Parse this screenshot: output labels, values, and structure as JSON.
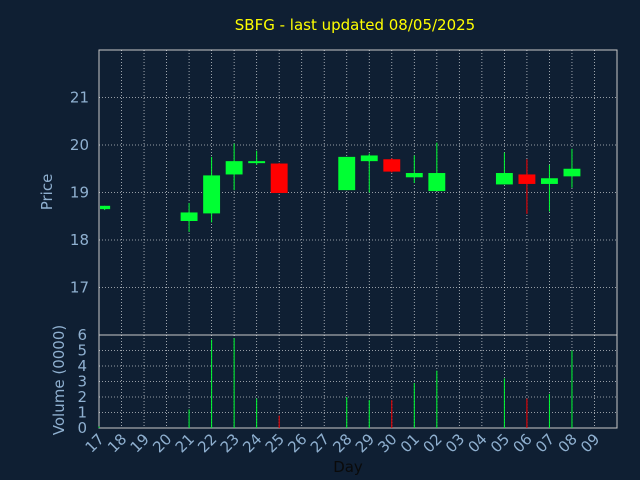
{
  "chart_data": [
    {
      "type": "candlestick",
      "title": "SBFG - last updated 08/05/2025",
      "xlabel": "Day",
      "ylabel": "Price",
      "ylim": [
        16,
        22
      ],
      "y_ticks": [
        "17",
        "18",
        "19",
        "20",
        "21"
      ],
      "x_ticks": [
        "17",
        "18",
        "19",
        "20",
        "21",
        "22",
        "23",
        "24",
        "25",
        "26",
        "27",
        "28",
        "29",
        "30",
        "01",
        "02",
        "03",
        "04",
        "05",
        "06",
        "07",
        "08",
        "09"
      ],
      "grid": true,
      "colors": {
        "up": "#00ff33",
        "down": "#ff0000",
        "background": "#0f1f33",
        "grid": "#ffffff",
        "text": "#8fb0d0",
        "title": "#ffff00"
      },
      "candles": [
        {
          "day": "17",
          "open": 18.65,
          "high": 18.72,
          "low": 18.63,
          "close": 18.72
        },
        {
          "day": "21",
          "open": 18.4,
          "high": 18.78,
          "low": 18.17,
          "close": 18.58
        },
        {
          "day": "22",
          "open": 18.56,
          "high": 19.75,
          "low": 18.37,
          "close": 19.36
        },
        {
          "day": "23",
          "open": 19.38,
          "high": 20.03,
          "low": 19.05,
          "close": 19.66
        },
        {
          "day": "24",
          "open": 19.62,
          "high": 19.88,
          "low": 19.58,
          "close": 19.66
        },
        {
          "day": "25",
          "open": 19.61,
          "high": 19.62,
          "low": 18.99,
          "close": 18.99
        },
        {
          "day": "28",
          "open": 19.05,
          "high": 19.75,
          "low": 19.05,
          "close": 19.75
        },
        {
          "day": "29",
          "open": 19.66,
          "high": 19.82,
          "low": 19.0,
          "close": 19.78
        },
        {
          "day": "30",
          "open": 19.7,
          "high": 19.72,
          "low": 19.42,
          "close": 19.44
        },
        {
          "day": "01",
          "open": 19.32,
          "high": 19.78,
          "low": 19.2,
          "close": 19.41
        },
        {
          "day": "02",
          "open": 19.03,
          "high": 20.05,
          "low": 19.03,
          "close": 19.41
        },
        {
          "day": "05",
          "open": 19.17,
          "high": 19.84,
          "low": 19.17,
          "close": 19.41
        },
        {
          "day": "06",
          "open": 19.38,
          "high": 19.7,
          "low": 18.55,
          "close": 19.18
        },
        {
          "day": "07",
          "open": 19.18,
          "high": 19.58,
          "low": 18.6,
          "close": 19.3
        },
        {
          "day": "08",
          "open": 19.34,
          "high": 19.92,
          "low": 19.1,
          "close": 19.5
        }
      ]
    },
    {
      "type": "bar",
      "ylabel": "Volume (0000)",
      "ylim": [
        0,
        6
      ],
      "y_ticks": [
        "0",
        "1",
        "2",
        "3",
        "4",
        "5",
        "6"
      ],
      "categories": [
        "17",
        "21",
        "22",
        "23",
        "24",
        "25",
        "28",
        "29",
        "30",
        "01",
        "02",
        "05",
        "06",
        "07",
        "08"
      ],
      "values": [
        0.1,
        1.2,
        5.7,
        5.8,
        1.9,
        0.8,
        2.0,
        1.8,
        1.8,
        2.9,
        3.7,
        3.2,
        1.9,
        2.2,
        5.0
      ],
      "directions": [
        "up",
        "up",
        "up",
        "up",
        "up",
        "down",
        "up",
        "up",
        "down",
        "up",
        "up",
        "up",
        "down",
        "up",
        "up"
      ]
    }
  ]
}
